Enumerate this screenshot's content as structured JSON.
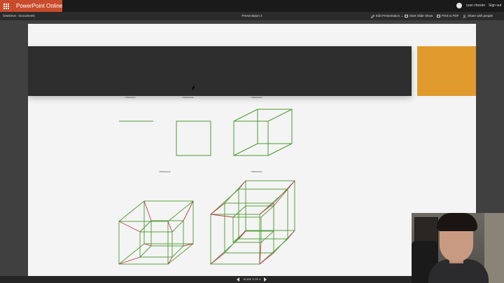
{
  "app": {
    "brand": "PowerPoint Online",
    "user": "ryan chesler",
    "sign_out": "Sign out"
  },
  "breadcrumb": {
    "items": [
      "OneDrive",
      "Documents"
    ],
    "separator": "›"
  },
  "document": {
    "title": "Presentation 2"
  },
  "commands": {
    "edit": "Edit Presentation ⌄",
    "slideshow": "Start Slide Show",
    "print": "Print to PDF",
    "share": "Share with people"
  },
  "slide": {
    "captions": [
      "1 Dimension",
      "2 Dimensions",
      "3 Dimensions",
      "4 Dimensions",
      "5 Dimensions"
    ],
    "colors": {
      "background": "#f4f4f4",
      "band": "#2d2d2d",
      "accent": "#e09a2e",
      "edge_green": "#4a9a2e",
      "edge_red": "#c0394a"
    }
  },
  "status": {
    "slide_counter": "SLIDE 3 OF 4"
  },
  "icons": {
    "app_launcher": "waffle-icon",
    "skype": "skype-icon",
    "edit": "pencil-icon",
    "slideshow": "projector-icon",
    "print": "printer-icon",
    "share": "share-icon",
    "prev": "triangle-left-icon",
    "next": "triangle-right-icon"
  }
}
